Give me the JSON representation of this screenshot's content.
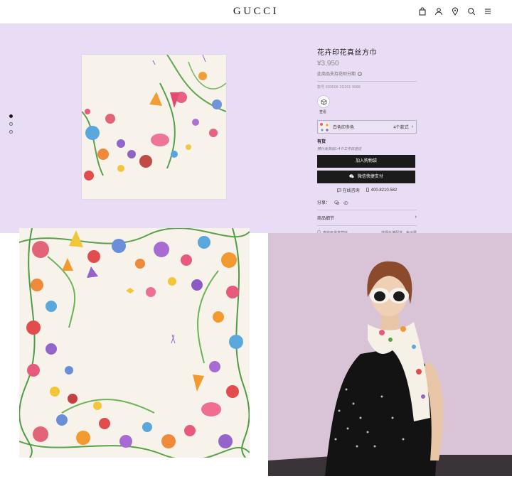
{
  "header": {
    "logo": "GUCCI",
    "icons": [
      "shopping-bag-icon",
      "user-icon",
      "location-pin-icon",
      "search-icon",
      "menu-icon"
    ]
  },
  "colors": {
    "panel_bg": "#e9dcf5",
    "button_bg": "#1b1b1b",
    "button_text": "#ffffff",
    "model_bg": "#d9c3d7"
  },
  "carousel": {
    "count": 3,
    "active": 0
  },
  "product": {
    "title": "花卉印花真丝方巾",
    "price": "¥3,950",
    "installment": "此商品支持花呗分期",
    "sku": "款号 699506 3G001 9088",
    "swatch_label": "查看",
    "variant_name": "白色印多色",
    "variant_count": "4个款式",
    "stock_status": "有货",
    "shipping_note": "预计发货后1-4个工作日送达",
    "add_to_bag": "加入购物袋",
    "wechat_pay": "微信快捷支付",
    "contact_chat": "在线咨询",
    "contact_phone": "400.8210.582",
    "share_label": "分享：",
    "details_label": "商品细节",
    "store_label": "查找有货直营店",
    "store_note": "选择在港配送，免运费"
  }
}
